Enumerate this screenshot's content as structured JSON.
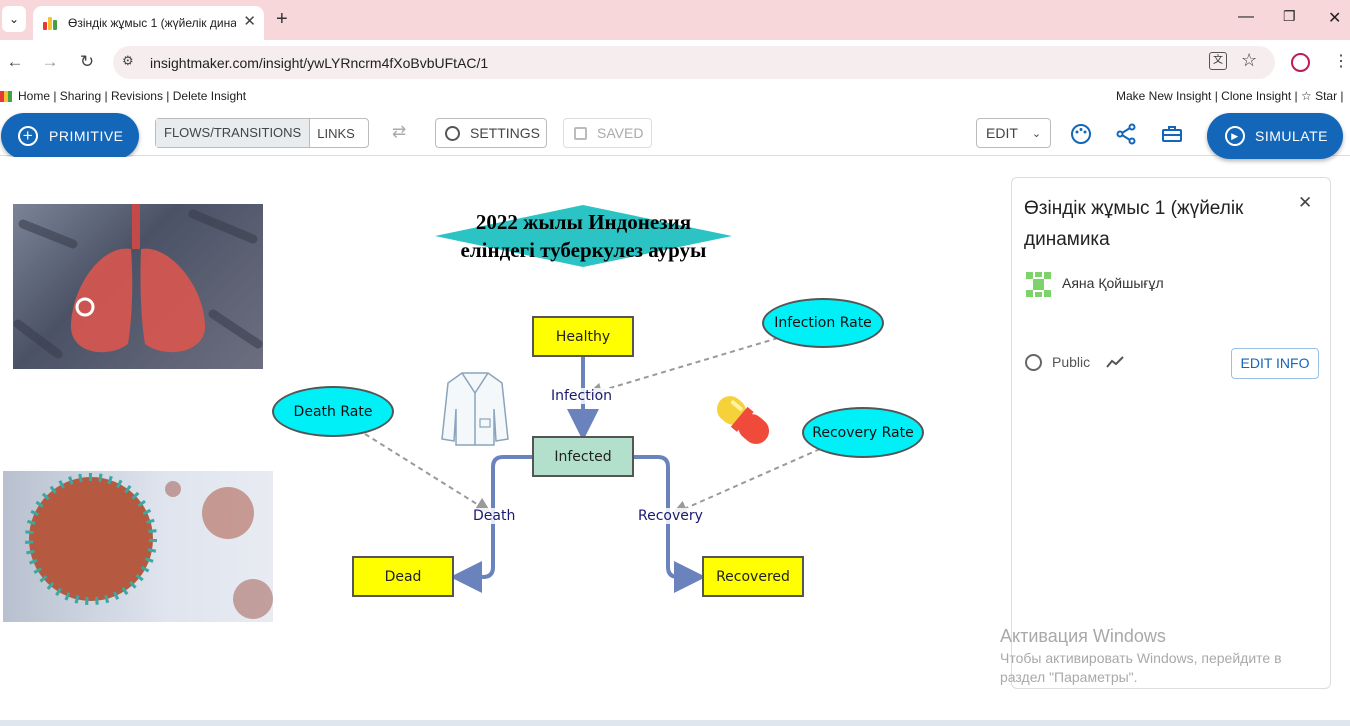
{
  "browser": {
    "tab_title": "Өзіндік жұмыс 1 (жүйелік дина",
    "url": "insightmaker.com/insight/ywLYRncrm4fXoBvbUFtAC/1",
    "window_controls": [
      "—",
      "❐",
      "✕"
    ]
  },
  "site_nav": {
    "left": "Home | Sharing | Revisions | Delete Insight",
    "right": "Make New Insight | Clone Insight | ☆ Star | "
  },
  "toolbar": {
    "primitive": "PRIMITIVE",
    "flows": "FLOWS/TRANSITIONS",
    "links": "LINKS",
    "settings": "SETTINGS",
    "saved": "SAVED",
    "edit": "EDIT",
    "simulate": "SIMULATE"
  },
  "diagram": {
    "title_line1": "2022 жылы Индонезия",
    "title_line2": "еліндегі туберкулез ауруы",
    "stocks": {
      "healthy": "Healthy",
      "infected": "Infected",
      "dead": "Dead",
      "recovered": "Recovered"
    },
    "variables": {
      "infection_rate": "Infection Rate",
      "death_rate": "Death Rate",
      "recovery_rate": "Recovery Rate"
    },
    "flows": {
      "infection": "Infection",
      "death": "Death",
      "recovery": "Recovery"
    },
    "colors": {
      "stock_yellow": "#ffff00",
      "stock_green": "#b3e0cc",
      "variable_cyan": "#00f0f8",
      "flow_blue": "#6a83bd",
      "title_diamond": "#2bc3c3"
    }
  },
  "panel": {
    "title": "Өзіндік жұмыс 1 (жүйелік динамика",
    "author": "Аяна Қойшығұл",
    "visibility": "Public",
    "edit_info": "EDIT INFO"
  },
  "watermark": {
    "line1": "Активация Windows",
    "line2": "Чтобы активировать Windows, перейдите в",
    "line3": "раздел \"Параметры\"."
  }
}
